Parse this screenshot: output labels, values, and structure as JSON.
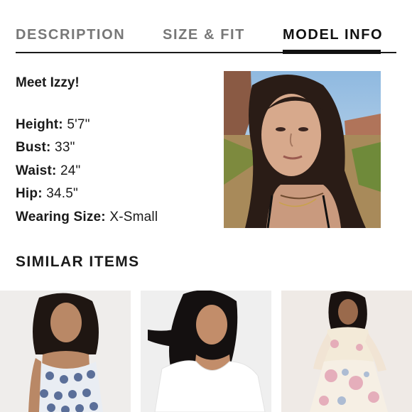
{
  "tabs": {
    "description": "DESCRIPTION",
    "size_fit": "SIZE & FIT",
    "model_info": "MODEL INFO"
  },
  "model": {
    "greeting": "Meet Izzy!",
    "stats": [
      {
        "label": "Height:",
        "value": "5'7\""
      },
      {
        "label": "Bust:",
        "value": "33\""
      },
      {
        "label": "Waist:",
        "value": "24\""
      },
      {
        "label": "Hip:",
        "value": "34.5\""
      },
      {
        "label": "Wearing Size:",
        "value": "X-Small"
      }
    ]
  },
  "similar": {
    "heading": "SIMILAR ITEMS"
  }
}
